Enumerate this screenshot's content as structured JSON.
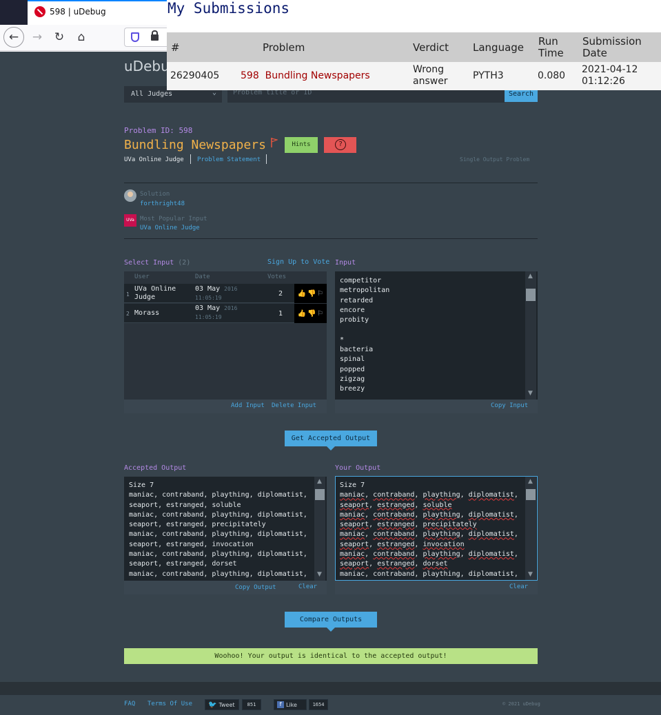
{
  "browser": {
    "tab_title": "598 | uDebug",
    "nav": {
      "back": "←",
      "forward": "→",
      "reload": "↻",
      "home": "⌂"
    }
  },
  "submissions": {
    "title": "My Submissions",
    "headers": [
      "#",
      "Problem",
      "Verdict",
      "Language",
      "Run Time",
      "Submission Date"
    ],
    "row": {
      "id": "26290405",
      "problem": "598  Bundling Newspapers",
      "verdict": "Wrong answer",
      "language": "PYTH3",
      "run_time": "0.080",
      "date": "2021-04-12 01:12:26"
    }
  },
  "page": {
    "logo": "uDebug",
    "judge_select": "All Judges",
    "search_placeholder": "Problem title or ID",
    "search_button": "Search",
    "problem_id": "Problem ID: 598",
    "problem_title": "Bundling Newspapers",
    "hints_button": "Hints",
    "help_button": "?",
    "judge_name": "UVa Online Judge",
    "statement_link": "Problem Statement",
    "single_output": "Single Output Problem",
    "solution_label": "Solution",
    "solution_user": "forthright48",
    "popular_label": "Most Popular Input",
    "popular_value": "UVa Online Judge",
    "uva_logo_text": "UVa"
  },
  "select_input": {
    "label": "Select Input",
    "count": "(2)",
    "vote_link": "Sign Up to Vote",
    "headers": {
      "user": "User",
      "date": "Date",
      "votes": "Votes"
    },
    "rows": [
      {
        "num": "1",
        "user": "UVa Online Judge",
        "date": "03 May",
        "year": "2016",
        "time": "11:05:19",
        "votes": "2"
      },
      {
        "num": "2",
        "user": "Morass",
        "date": "03 May",
        "year": "2016",
        "time": "11:05:19",
        "votes": "1"
      }
    ],
    "add_input": "Add Input",
    "delete_input": "Delete Input"
  },
  "input": {
    "label": "Input",
    "lines": "competitor\nmetropolitan\nretarded\nencore\nprobity\n\n*\nbacteria\nspinal\npopped\nzigzag\nbreezy",
    "copy_input": "Copy Input"
  },
  "get_output_button": "Get Accepted Output",
  "accepted_output": {
    "label": "Accepted Output",
    "text": "Size 7\nmaniac, contraband, plaything, diplomatist,\nseaport, estranged, soluble\nmaniac, contraband, plaything, diplomatist,\nseaport, estranged, precipitately\nmaniac, contraband, plaything, diplomatist,\nseaport, estranged, invocation\nmaniac, contraband, plaything, diplomatist,\nseaport, estranged, dorset\nmaniac, contraband, plaything, diplomatist,",
    "copy_output": "Copy Output",
    "clear": "Clear"
  },
  "your_output": {
    "label": "Your Output",
    "size_line": "Size 7",
    "tail_line": "maniac, contraband, plaything, diplomatist,",
    "groups": [
      [
        "soluble"
      ],
      [
        "precipitately"
      ],
      [
        "invocation"
      ],
      [
        "dorset"
      ]
    ],
    "clear": "Clear"
  },
  "compare_button": "Compare Outputs",
  "result_message": "Woohoo! Your output is identical to the accepted output!",
  "footer": {
    "faq": "FAQ",
    "terms": "Terms Of Use",
    "tweet": "Tweet",
    "tweet_count": "851",
    "like": "Like",
    "like_count": "1654",
    "copyright": "© 2021 uDebug"
  }
}
